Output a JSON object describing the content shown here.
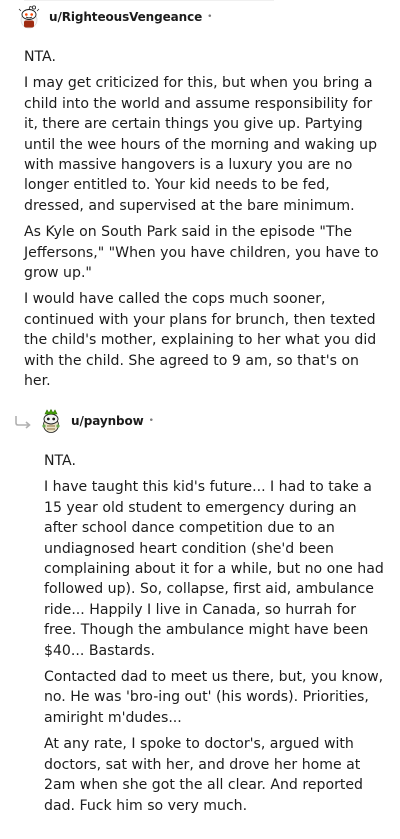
{
  "comments": [
    {
      "username": "u/RighteousVengeance",
      "separator": "•",
      "avatar_icon": "reddit-snoo-avatar-icon",
      "paragraphs": [
        "NTA.",
        "I may get criticized for this, but when you bring a child into the world and assume responsibility for it, there are certain things you give up. Partying until the wee hours of the morning and waking up with massive hangovers is a luxury you are no longer entitled to. Your kid needs to be fed, dressed, and supervised at the bare minimum.",
        "As Kyle on South Park said in the episode \"The Jeffersons,\" \"When you have children, you have to grow up.\"",
        "I would have called the cops much sooner, continued with your plans for brunch, then texted the child's mother, explaining to her what you did with the child. She agreed to 9 am, so that's on her."
      ]
    },
    {
      "username": "u/paynbow",
      "separator": "•",
      "avatar_icon": "reddit-snoo-avatar-icon",
      "reply_icon": "reply-arrow-icon",
      "paragraphs": [
        "NTA.",
        "I have taught this kid's future... I had to take a 15 year old student to emergency during an after school dance competition due to an undiagnosed heart condition (she'd been complaining about it for a while, but no one had followed up). So, collapse, first aid, ambulance ride... Happily I live in Canada, so hurrah for free. Though the ambulance might have been $40... Bastards.",
        "Contacted dad to meet us there, but, you know, no. He was 'bro-ing out' (his words). Priorities, amiright m'dudes...",
        "At any rate, I spoke to doctor's, argued with doctors, sat with her, and drove her home at 2am when she got the all clear. And reported dad. Fuck him so very much."
      ]
    }
  ]
}
